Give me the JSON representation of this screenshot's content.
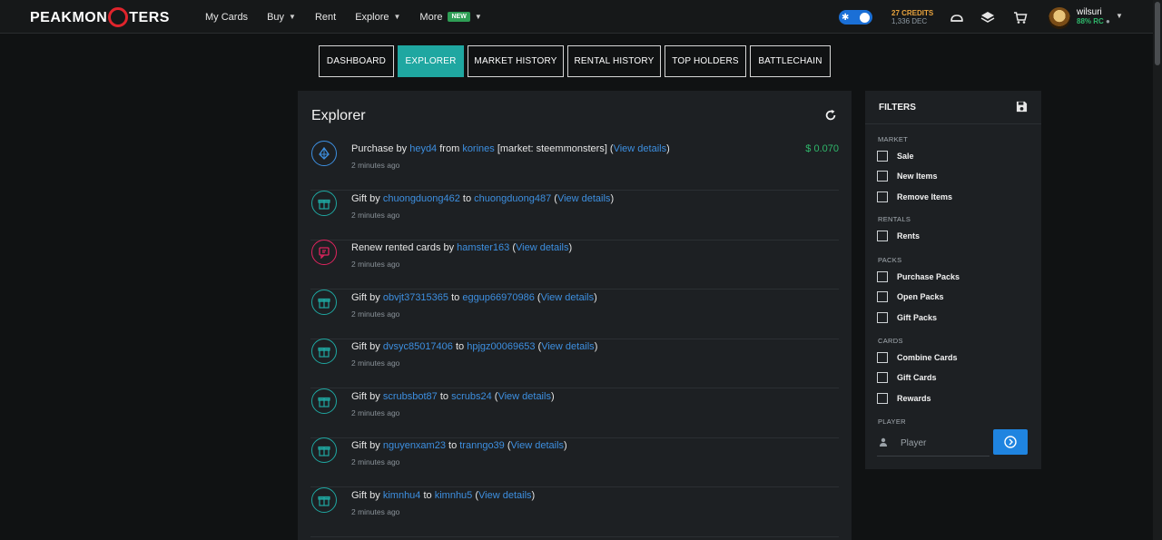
{
  "brand": {
    "logo_text_pre": "PEAKMON",
    "logo_text_post": "TERS"
  },
  "nav": {
    "links": [
      {
        "label": "My Cards"
      },
      {
        "label": "Buy",
        "dropdown": true
      },
      {
        "label": "Rent"
      },
      {
        "label": "Explore",
        "dropdown": true
      },
      {
        "label": "More",
        "badge": "NEW",
        "dropdown": true
      }
    ],
    "credits": "27 CREDITS",
    "dec": "1,336 DEC",
    "username": "wilsuri",
    "rc": "88% RC",
    "icons": [
      "cloud-icon",
      "layers-icon",
      "cart-icon"
    ]
  },
  "tabs": [
    {
      "label": "DASHBOARD",
      "active": false
    },
    {
      "label": "EXPLORER",
      "active": true
    },
    {
      "label": "MARKET HISTORY",
      "active": false
    },
    {
      "label": "RENTAL HISTORY",
      "active": false
    },
    {
      "label": "TOP HOLDERS",
      "active": false
    },
    {
      "label": "BATTLECHAIN",
      "active": false
    }
  ],
  "main": {
    "title": "Explorer",
    "view_details": "View details",
    "events": [
      {
        "type": "purchase",
        "prefix": "Purchase by ",
        "user1": "heyd4",
        "mid": " from ",
        "user2": "korines",
        "extra": " [market: steemmonsters] (",
        "time": "2 minutes ago",
        "amount": "$ 0.070",
        "color": "#3d8fe0"
      },
      {
        "type": "gift",
        "prefix": "Gift by ",
        "user1": "chuongduong462",
        "mid": " to ",
        "user2": "chuongduong487",
        "extra": " (",
        "time": "2 minutes ago",
        "color": "#1fa7a1"
      },
      {
        "type": "rent",
        "prefix": "Renew rented cards by ",
        "user1": "hamster163",
        "mid": "",
        "user2": "",
        "extra": " (",
        "time": "2 minutes ago",
        "color": "#e0245e"
      },
      {
        "type": "gift",
        "prefix": "Gift by ",
        "user1": "obvjt37315365",
        "mid": " to ",
        "user2": "eggup66970986",
        "extra": " (",
        "time": "2 minutes ago",
        "color": "#1fa7a1"
      },
      {
        "type": "gift",
        "prefix": "Gift by ",
        "user1": "dvsyc85017406",
        "mid": " to ",
        "user2": "hpjgz00069653",
        "extra": " (",
        "time": "2 minutes ago",
        "color": "#1fa7a1"
      },
      {
        "type": "gift",
        "prefix": "Gift by ",
        "user1": "scrubsbot87",
        "mid": " to ",
        "user2": "scrubs24",
        "extra": " (",
        "time": "2 minutes ago",
        "color": "#1fa7a1"
      },
      {
        "type": "gift",
        "prefix": "Gift by ",
        "user1": "nguyenxam23",
        "mid": " to ",
        "user2": "tranngo39",
        "extra": " (",
        "time": "2 minutes ago",
        "color": "#1fa7a1"
      },
      {
        "type": "gift",
        "prefix": "Gift by ",
        "user1": "kimnhu4",
        "mid": " to ",
        "user2": "kimnhu5",
        "extra": " (",
        "time": "2 minutes ago",
        "color": "#1fa7a1"
      }
    ]
  },
  "filters": {
    "title": "FILTERS",
    "sections": [
      {
        "label": "MARKET",
        "items": [
          "Sale",
          "New Items",
          "Remove Items"
        ]
      },
      {
        "label": "RENTALS",
        "items": [
          "Rents"
        ]
      },
      {
        "label": "PACKS",
        "items": [
          "Purchase Packs",
          "Open Packs",
          "Gift Packs"
        ]
      },
      {
        "label": "CARDS",
        "items": [
          "Combine Cards",
          "Gift Cards",
          "Rewards"
        ]
      }
    ],
    "player_label": "PLAYER",
    "player_placeholder": "Player"
  }
}
